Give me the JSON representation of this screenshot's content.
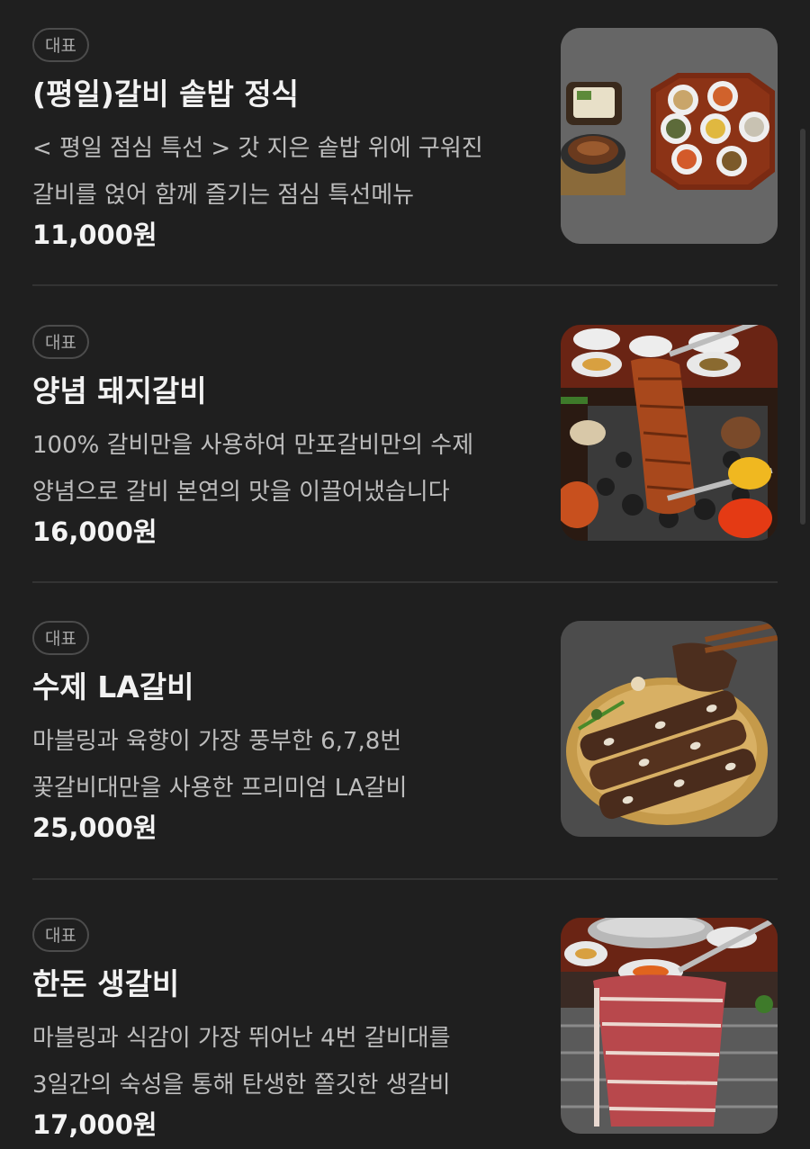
{
  "menu": {
    "items": [
      {
        "badge": "대표",
        "name": "(평일)갈비 솥밥 정식",
        "description": "< 평일 점심 특선 > 갓 지은 솥밥 위에 구워진 갈비를 얹어 함께 즐기는 점심 특선메뉴",
        "price": "11,000원",
        "image": "galbi-sotbap-set-photo"
      },
      {
        "badge": "대표",
        "name": "양념 돼지갈비",
        "description": "100% 갈비만을 사용하여 만포갈비만의 수제 양념으로 갈비 본연의 맛을 이끌어냈습니다",
        "price": "16,000원",
        "image": "marinated-pork-galbi-photo"
      },
      {
        "badge": "대표",
        "name": "수제 LA갈비",
        "description": "마블링과 육향이 가장 풍부한 6,7,8번 꽃갈비대만을 사용한 프리미엄 LA갈비",
        "price": "25,000원",
        "image": "la-galbi-photo"
      },
      {
        "badge": "대표",
        "name": "한돈 생갈비",
        "description": "마블링과 식감이 가장 뛰어난 4번 갈비대를 3일간의 숙성을 통해 탄생한 쫄깃한 생갈비",
        "price": "17,000원",
        "image": "handon-fresh-galbi-photo"
      }
    ]
  },
  "colors": {
    "background": "#1f1f1f",
    "text_primary": "#f2f2f2",
    "text_secondary": "#bdbdbd",
    "badge_border": "#4c4c4c",
    "divider": "#333333"
  }
}
